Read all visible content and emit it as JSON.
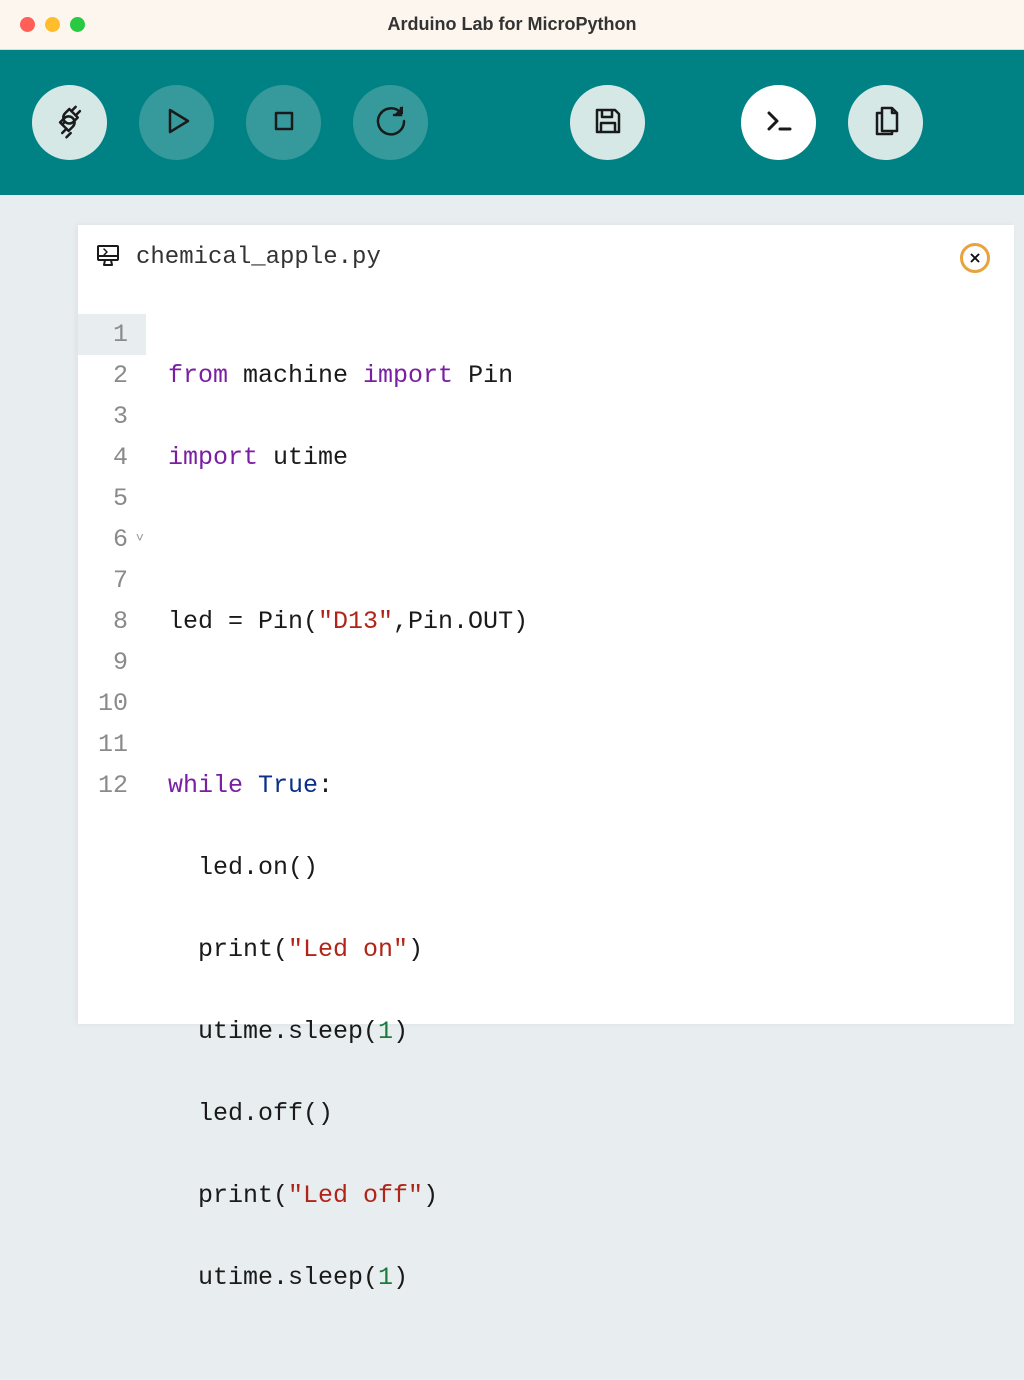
{
  "titlebar": {
    "title": "Arduino Lab for MicroPython"
  },
  "toolbar": {
    "connect": "connect",
    "run": "run",
    "stop": "stop",
    "reload": "reload",
    "save": "save",
    "terminal": "terminal",
    "files": "files"
  },
  "tab": {
    "filename": "chemical_apple.py",
    "close": "×"
  },
  "code": {
    "lines": [
      {
        "num": "1",
        "fold": false
      },
      {
        "num": "2",
        "fold": false
      },
      {
        "num": "3",
        "fold": false
      },
      {
        "num": "4",
        "fold": false
      },
      {
        "num": "5",
        "fold": false
      },
      {
        "num": "6",
        "fold": true
      },
      {
        "num": "7",
        "fold": false
      },
      {
        "num": "8",
        "fold": false
      },
      {
        "num": "9",
        "fold": false
      },
      {
        "num": "10",
        "fold": false
      },
      {
        "num": "11",
        "fold": false
      },
      {
        "num": "12",
        "fold": false
      }
    ],
    "tokens": {
      "l1_from": "from",
      "l1_machine": " machine ",
      "l1_import": "import",
      "l1_pin": " Pin",
      "l2_import": "import",
      "l2_utime": " utime",
      "l4_lhs": "led = Pin(",
      "l4_str": "\"D13\"",
      "l4_rhs": ",Pin.OUT)",
      "l6_while": "while",
      "l6_sp": " ",
      "l6_true": "True",
      "l6_colon": ":",
      "l7": "  led.on()",
      "l8_a": "  print(",
      "l8_str": "\"Led on\"",
      "l8_b": ")",
      "l9_a": "  utime.sleep(",
      "l9_num": "1",
      "l9_b": ")",
      "l10": "  led.off()",
      "l11_a": "  print(",
      "l11_str": "\"Led off\"",
      "l11_b": ")",
      "l12_a": "  utime.sleep(",
      "l12_num": "1",
      "l12_b": ")"
    },
    "fold_marker": "˅"
  }
}
